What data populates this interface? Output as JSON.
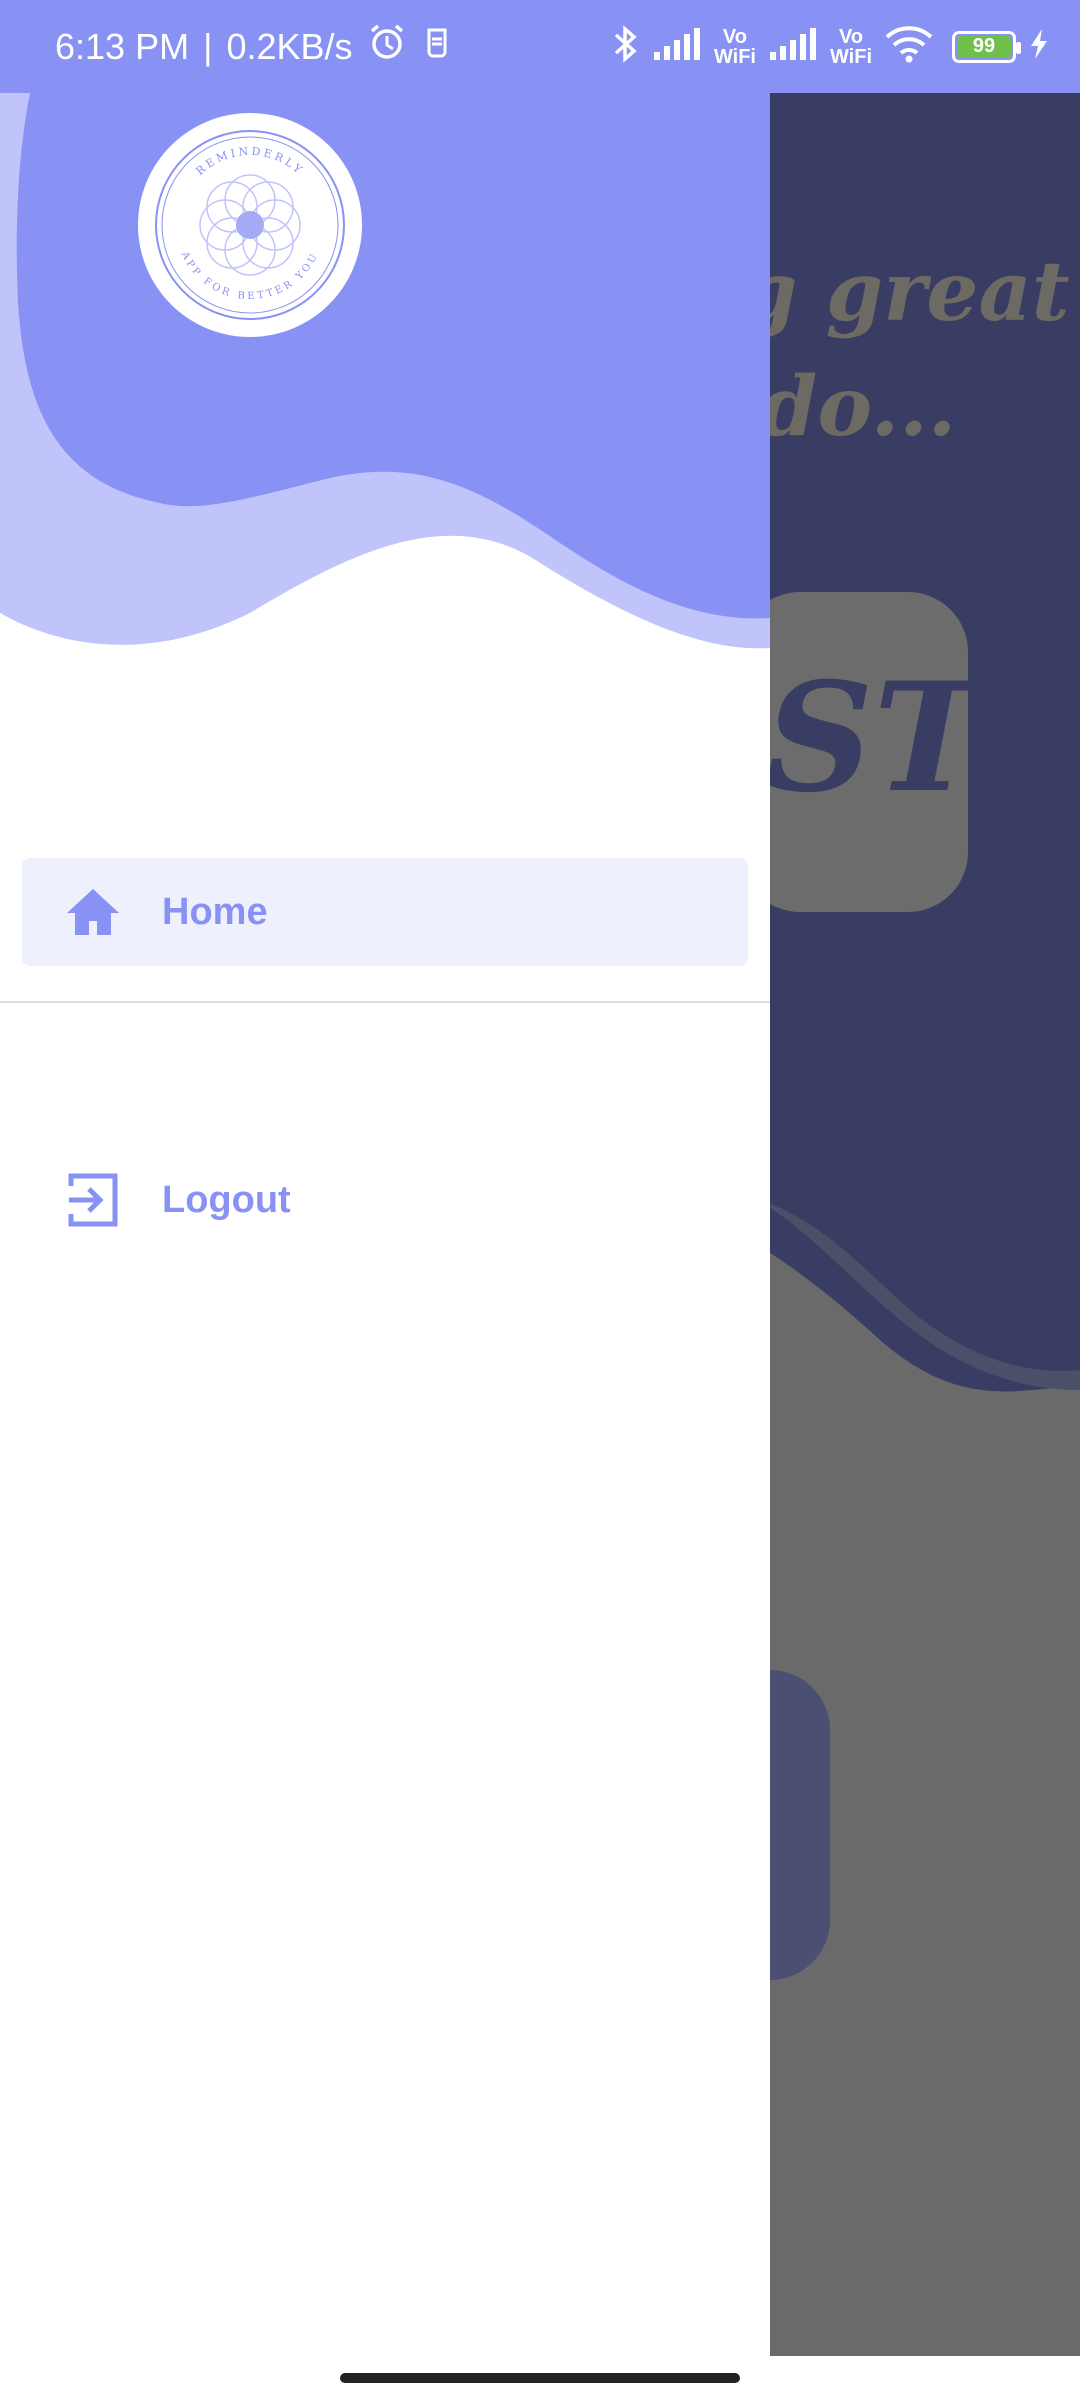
{
  "status_bar": {
    "time": "6:13 PM",
    "separator": "|",
    "net_speed": "0.2KB/s",
    "vowifi_1": "Vo\nWiFi",
    "vowifi_2": "Vo\nWiFi",
    "battery_level": "99",
    "icons": [
      "alarm-icon",
      "sim-icon",
      "bluetooth-icon",
      "signal-icon",
      "wifi-icon",
      "battery-icon",
      "charging-icon"
    ]
  },
  "background_app": {
    "quote_line1": "g great",
    "quote_line2": "do...",
    "list_fragment": "ST"
  },
  "drawer": {
    "logo": {
      "top_text": "REMINDERLY",
      "bottom_text": "APP FOR BETTER YOU"
    },
    "items": [
      {
        "label": "Home",
        "icon": "home-icon",
        "active": true
      },
      {
        "label": "Logout",
        "icon": "logout-icon",
        "active": false
      }
    ]
  },
  "colors": {
    "accent": "#8891f4",
    "accent_light": "#c0c4fa",
    "active_bg": "#eef0fd",
    "scrim_dark": "#393c63"
  }
}
